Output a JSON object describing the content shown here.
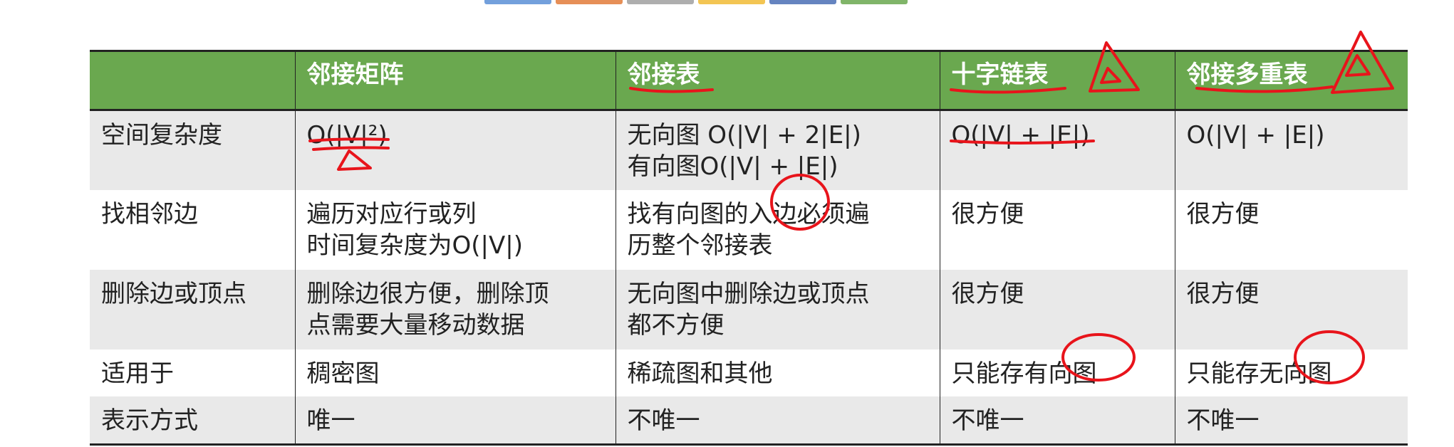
{
  "top_tabs": [
    {
      "color": "#5b8fd6"
    },
    {
      "color": "#e27b3a"
    },
    {
      "color": "#a0a0a0"
    },
    {
      "color": "#f1bb35"
    },
    {
      "color": "#4a6fb5"
    },
    {
      "color": "#6aa84f"
    }
  ],
  "table": {
    "header_color": "#6aa84f",
    "columns": [
      "",
      "邻接矩阵",
      "邻接表",
      "十字链表",
      "邻接多重表"
    ],
    "rows": [
      {
        "label": "空间复杂度",
        "cells": [
          [
            "O(|V|²)"
          ],
          [
            "无向图 O(|V| + 2|E|)",
            "有向图O(|V| + |E|)"
          ],
          [
            "O(|V| + |E|)"
          ],
          [
            "O(|V| + |E|)"
          ]
        ]
      },
      {
        "label": "找相邻边",
        "cells": [
          [
            "遍历对应行或列",
            "时间复杂度为O(|V|)"
          ],
          [
            "找有向图的入边必须遍",
            "历整个邻接表"
          ],
          [
            "很方便"
          ],
          [
            "很方便"
          ]
        ]
      },
      {
        "label": "删除边或顶点",
        "cells": [
          [
            "删除边很方便，删除顶",
            "点需要大量移动数据"
          ],
          [
            "无向图中删除边或顶点",
            "都不方便"
          ],
          [
            "很方便"
          ],
          [
            "很方便"
          ]
        ]
      },
      {
        "label": "适用于",
        "cells": [
          [
            "稠密图"
          ],
          [
            "稀疏图和其他"
          ],
          [
            "只能存有向图"
          ],
          [
            "只能存无向图"
          ]
        ]
      },
      {
        "label": "表示方式",
        "cells": [
          [
            "唯一"
          ],
          [
            "不唯一"
          ],
          [
            "不唯一"
          ],
          [
            "不唯一"
          ]
        ]
      }
    ]
  },
  "annotation_color": "#e8141b"
}
